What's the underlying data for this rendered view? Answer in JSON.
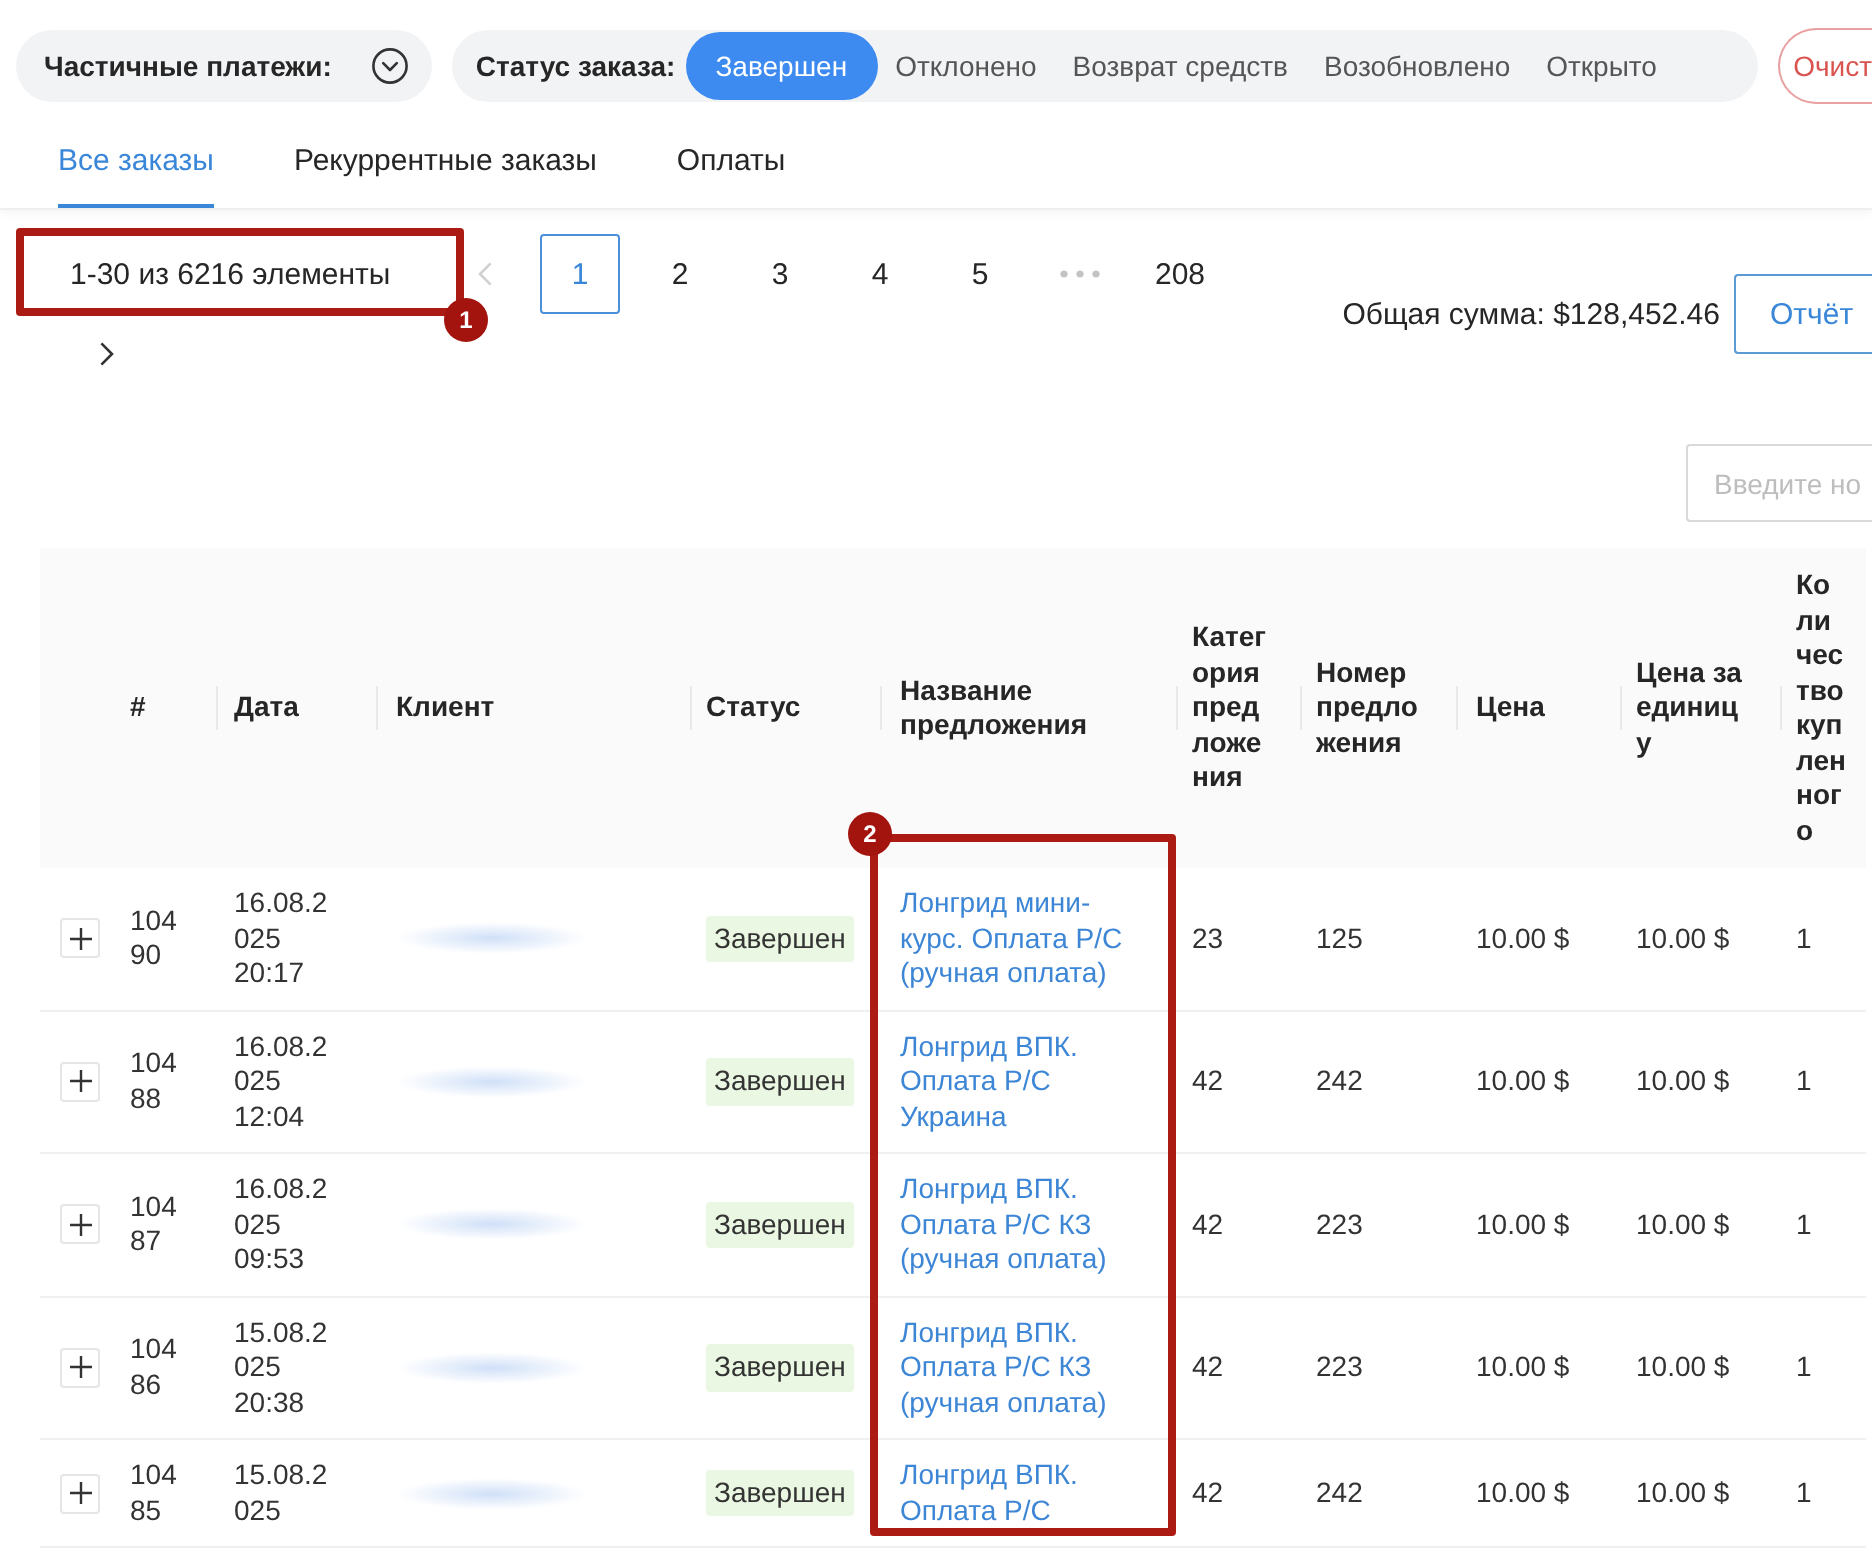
{
  "filters": {
    "partial_payments": {
      "label": "Частичные платежи:"
    },
    "order_status": {
      "label": "Статус заказа:",
      "options": [
        {
          "label": "Завершен",
          "selected": true
        },
        {
          "label": "Отклонено",
          "selected": false
        },
        {
          "label": "Возврат средств",
          "selected": false
        },
        {
          "label": "Возобновлено",
          "selected": false
        },
        {
          "label": "Открыто",
          "selected": false
        }
      ]
    },
    "clear_button": "Очист"
  },
  "tabs": [
    {
      "label": "Все заказы",
      "selected": true
    },
    {
      "label": "Рекуррентные заказы",
      "selected": false
    },
    {
      "label": "Оплаты",
      "selected": false
    }
  ],
  "pagination": {
    "total": "1-30 из 6216 элементы",
    "total_annotation": "1",
    "prev": {
      "disabled": true
    },
    "pages": [
      {
        "kind": "page",
        "label": "1",
        "selected": true
      },
      {
        "kind": "page",
        "label": "2",
        "selected": false
      },
      {
        "kind": "page",
        "label": "3",
        "selected": false
      },
      {
        "kind": "page",
        "label": "4",
        "selected": false
      },
      {
        "kind": "page",
        "label": "5",
        "selected": false
      },
      {
        "kind": "ellipsis"
      },
      {
        "kind": "page",
        "label": "208",
        "selected": false
      }
    ],
    "next": {
      "disabled": false
    }
  },
  "summary": {
    "total": "Общая сумма: $128,452.46",
    "report_button": "Отчёт"
  },
  "search": {
    "placeholder": "Введите но"
  },
  "table": {
    "columns": [
      {
        "label": "#"
      },
      {
        "label": "Дата"
      },
      {
        "label": "Клиент"
      },
      {
        "label": "Статус"
      },
      {
        "label": "Название предложения",
        "annotation": "2"
      },
      {
        "label": "Категория предложения"
      },
      {
        "label": "Номер предложения"
      },
      {
        "label": "Цена"
      },
      {
        "label": "Цена за единицу"
      },
      {
        "label": "Количество купленного"
      }
    ],
    "rows": [
      {
        "number": "10490",
        "date": "16.08.2025 20:17",
        "status": "Завершен",
        "offer": "Лонгрид мини-курс. Оплата Р/С (ручная оплата)",
        "category": "23",
        "offer_number": "125",
        "price": "10.00 $",
        "unit_price": "10.00 $",
        "quantity": "1"
      },
      {
        "number": "10488",
        "date": "16.08.2025 12:04",
        "status": "Завершен",
        "offer": "Лонгрид ВПК. Оплата Р/С Украина",
        "category": "42",
        "offer_number": "242",
        "price": "10.00 $",
        "unit_price": "10.00 $",
        "quantity": "1"
      },
      {
        "number": "10487",
        "date": "16.08.2025 09:53",
        "status": "Завершен",
        "offer": "Лонгрид ВПК. Оплата Р/С КЗ (ручная оплата)",
        "category": "42",
        "offer_number": "223",
        "price": "10.00 $",
        "unit_price": "10.00 $",
        "quantity": "1"
      },
      {
        "number": "10486",
        "date": "15.08.2025 20:38",
        "status": "Завершен",
        "offer": "Лонгрид ВПК. Оплата Р/С КЗ (ручная оплата)",
        "category": "42",
        "offer_number": "223",
        "price": "10.00 $",
        "unit_price": "10.00 $",
        "quantity": "1"
      },
      {
        "number": "10485",
        "date": "15.08.2025",
        "status": "Завершен",
        "offer": "Лонгрид ВПК. Оплата Р/С",
        "category": "42",
        "offer_number": "242",
        "price": "10.00 $",
        "unit_price": "10.00 $",
        "quantity": "1"
      }
    ]
  }
}
